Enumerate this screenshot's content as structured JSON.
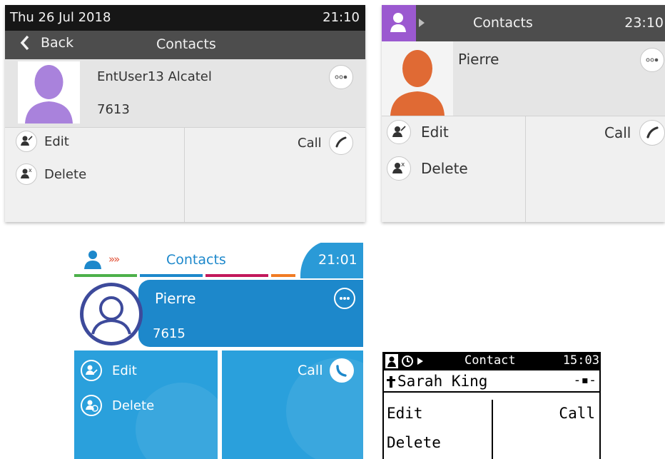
{
  "phoneA": {
    "status_date": "Thu 26 Jul 2018",
    "status_time": "21:10",
    "back_label": "Back",
    "title": "Contacts",
    "contact_name": "EntUser13 Alcatel",
    "contact_number": "7613",
    "edit_label": "Edit",
    "delete_label": "Delete",
    "call_label": "Call",
    "avatar_color": "#a982dc"
  },
  "phoneB": {
    "title": "Contacts",
    "time": "23:10",
    "contact_name": "Pierre",
    "edit_label": "Edit",
    "delete_label": "Delete",
    "call_label": "Call",
    "tab_color": "#9b59d0",
    "avatar_color": "#e06a34"
  },
  "phoneC": {
    "title": "Contacts",
    "chevrons": "»»",
    "time": "21:01",
    "contact_name": "Pierre",
    "contact_number": "7615",
    "edit_label": "Edit",
    "delete_label": "Delete",
    "call_label": "Call",
    "accent_color": "#1d88cb"
  },
  "phoneD": {
    "title": "Contact",
    "time": "15:03",
    "contact_name": "Sarah King",
    "number_mask": "-▪-",
    "edit_label": "Edit",
    "delete_label": "Delete",
    "call_label": "Call"
  }
}
